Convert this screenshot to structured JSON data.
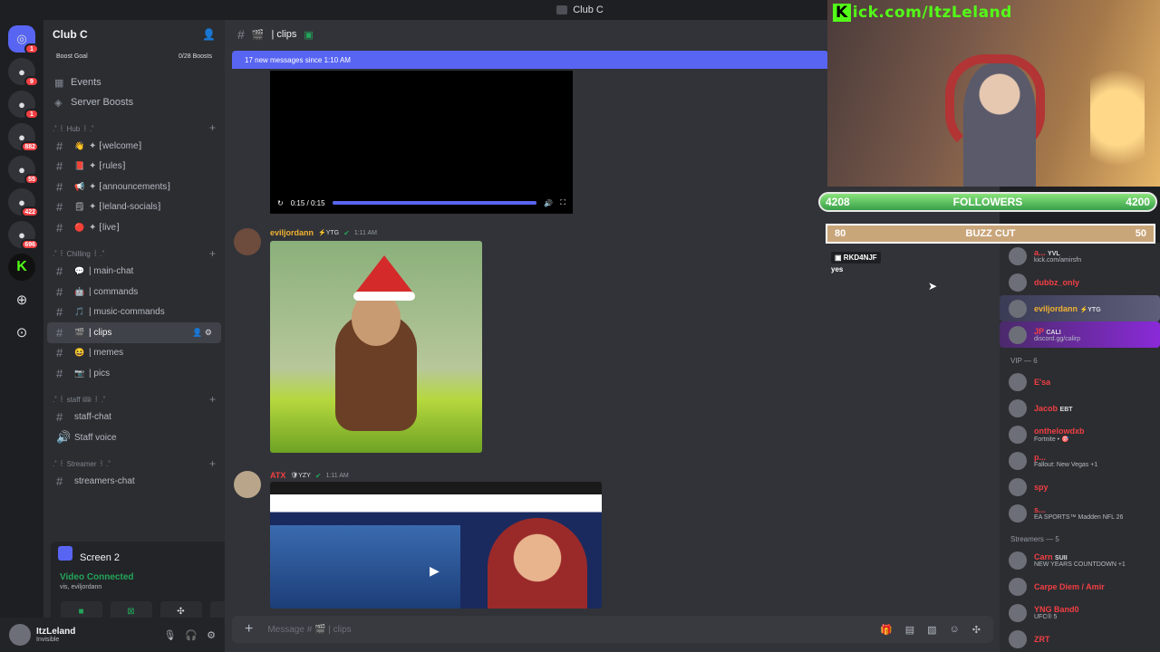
{
  "titlebar": {
    "title": "Club C"
  },
  "rail": {
    "servers": [
      {
        "icon": "discord-icon",
        "badge": "1"
      },
      {
        "icon": "server-icon",
        "badge": "9"
      },
      {
        "icon": "server-icon",
        "badge": "1"
      },
      {
        "icon": "server-icon",
        "badge": "882"
      },
      {
        "icon": "server-icon",
        "badge": "55"
      },
      {
        "icon": "server-icon",
        "badge": "422"
      },
      {
        "icon": "server-icon",
        "badge": "696"
      },
      {
        "icon": "kick-icon",
        "badge": ""
      },
      {
        "icon": "add-server-icon",
        "badge": ""
      },
      {
        "icon": "explore-icon",
        "badge": ""
      }
    ]
  },
  "sidebar": {
    "server_name": "Club C",
    "boost_goal": "Boost Goal",
    "boost_count": "0/28 Boosts",
    "events": "Events",
    "server_boosts": "Server Boosts",
    "categories": [
      {
        "name": ".˚ ꒰ Hub ꒱ .˚",
        "channels": [
          {
            "emoji": "👋",
            "name": "✦ ⁅welcome⁆"
          },
          {
            "emoji": "📕",
            "name": "✦ ⁅rules⁆"
          },
          {
            "emoji": "📢",
            "name": "✦ ⁅announcements⁆"
          },
          {
            "emoji": "🗒",
            "name": "✦ ⁅leland-socials⁆"
          },
          {
            "emoji": "🔴",
            "name": "✦ ⁅live⁆"
          }
        ]
      },
      {
        "name": ".˚ ꒰ Chilling ꒱ .˚",
        "channels": [
          {
            "emoji": "💬",
            "name": "| main-chat"
          },
          {
            "emoji": "🤖",
            "name": "| commands"
          },
          {
            "emoji": "🎵",
            "name": "| music-commands"
          },
          {
            "emoji": "🎬",
            "name": "| clips"
          },
          {
            "emoji": "😆",
            "name": "| memes"
          },
          {
            "emoji": "📷",
            "name": "| pics"
          }
        ]
      },
      {
        "name": ".˚ ꒰ staff 🎟 ꒱ .˚",
        "channels": [
          {
            "emoji": "",
            "name": "staff-chat"
          },
          {
            "emoji": "",
            "name": "Staff voice"
          }
        ]
      },
      {
        "name": ".˚ ꒰ Streamer ꒱ .˚",
        "channels": [
          {
            "emoji": "",
            "name": "streamers-chat"
          }
        ]
      }
    ]
  },
  "voice": {
    "screen_label": "Screen 2",
    "status": "Video Connected",
    "sub": "vis, eviljordann"
  },
  "user": {
    "name": "ItzLeland",
    "status": "Invisible"
  },
  "main": {
    "channel": "| clips",
    "new_messages": "17 new messages since 1:10 AM",
    "video_time": "0:15 / 0:15",
    "video_progress": 1.0,
    "msg1": {
      "author": "eviljordann",
      "tag": "⚡YTG",
      "time": "1:11 AM"
    },
    "msg2": {
      "author": "ATX",
      "tag": "🛡YZY",
      "time": "1:11 AM"
    },
    "composer_placeholder": "Message # 🎬 | clips"
  },
  "overlay": {
    "url": "ick.com/ItzLeland",
    "url_k": "K",
    "followers_label": "FOLLOWERS",
    "followers_current": "4208",
    "followers_goal": "4200",
    "buzz_label": "BUZZ CUT",
    "buzz_left": "80",
    "buzz_right": "50",
    "chat_user": "RKD4NJF",
    "chat_msg": "yes"
  },
  "members": {
    "top": [
      {
        "name": "a...",
        "tag": "YVL",
        "act": "kick.com/amirsfn",
        "color": "#f23f43"
      },
      {
        "name": "dubbz_only",
        "tag": "",
        "act": "",
        "color": "#f23f43"
      },
      {
        "name": "eviljordann",
        "tag": "⚡YTG",
        "act": "",
        "color": "#f0b232"
      },
      {
        "name": "JP",
        "tag": "CALI",
        "act": "discord.gg/calirp",
        "color": "#f23f43"
      }
    ],
    "vip_header": "VIP — 6",
    "vip": [
      {
        "name": "E'sa",
        "act": "",
        "color": "#f23f43"
      },
      {
        "name": "Jacob",
        "tag": "EBT",
        "act": "",
        "color": "#f23f43"
      },
      {
        "name": "onthelowdxb",
        "act": "Fortnite • 🎯",
        "color": "#f23f43"
      },
      {
        "name": "p...",
        "act": "Fallout: New Vegas +1",
        "color": "#f23f43"
      },
      {
        "name": "spy",
        "act": "",
        "color": "#f23f43"
      },
      {
        "name": "s...",
        "act": "EA SPORTS™ Madden NFL 26",
        "color": "#f23f43"
      }
    ],
    "streamers_header": "Streamers — 5",
    "streamers": [
      {
        "name": "Carn",
        "tag": "SUII",
        "act": "NEW YEARS COUNTDOWN +1",
        "color": "#f23f43"
      },
      {
        "name": "Carpe Diem / Amir",
        "act": "",
        "color": "#f23f43"
      },
      {
        "name": "YNG Band0",
        "act": "UFC® 5",
        "color": "#f23f43"
      },
      {
        "name": "ZRT",
        "act": "",
        "color": "#f23f43"
      }
    ]
  }
}
